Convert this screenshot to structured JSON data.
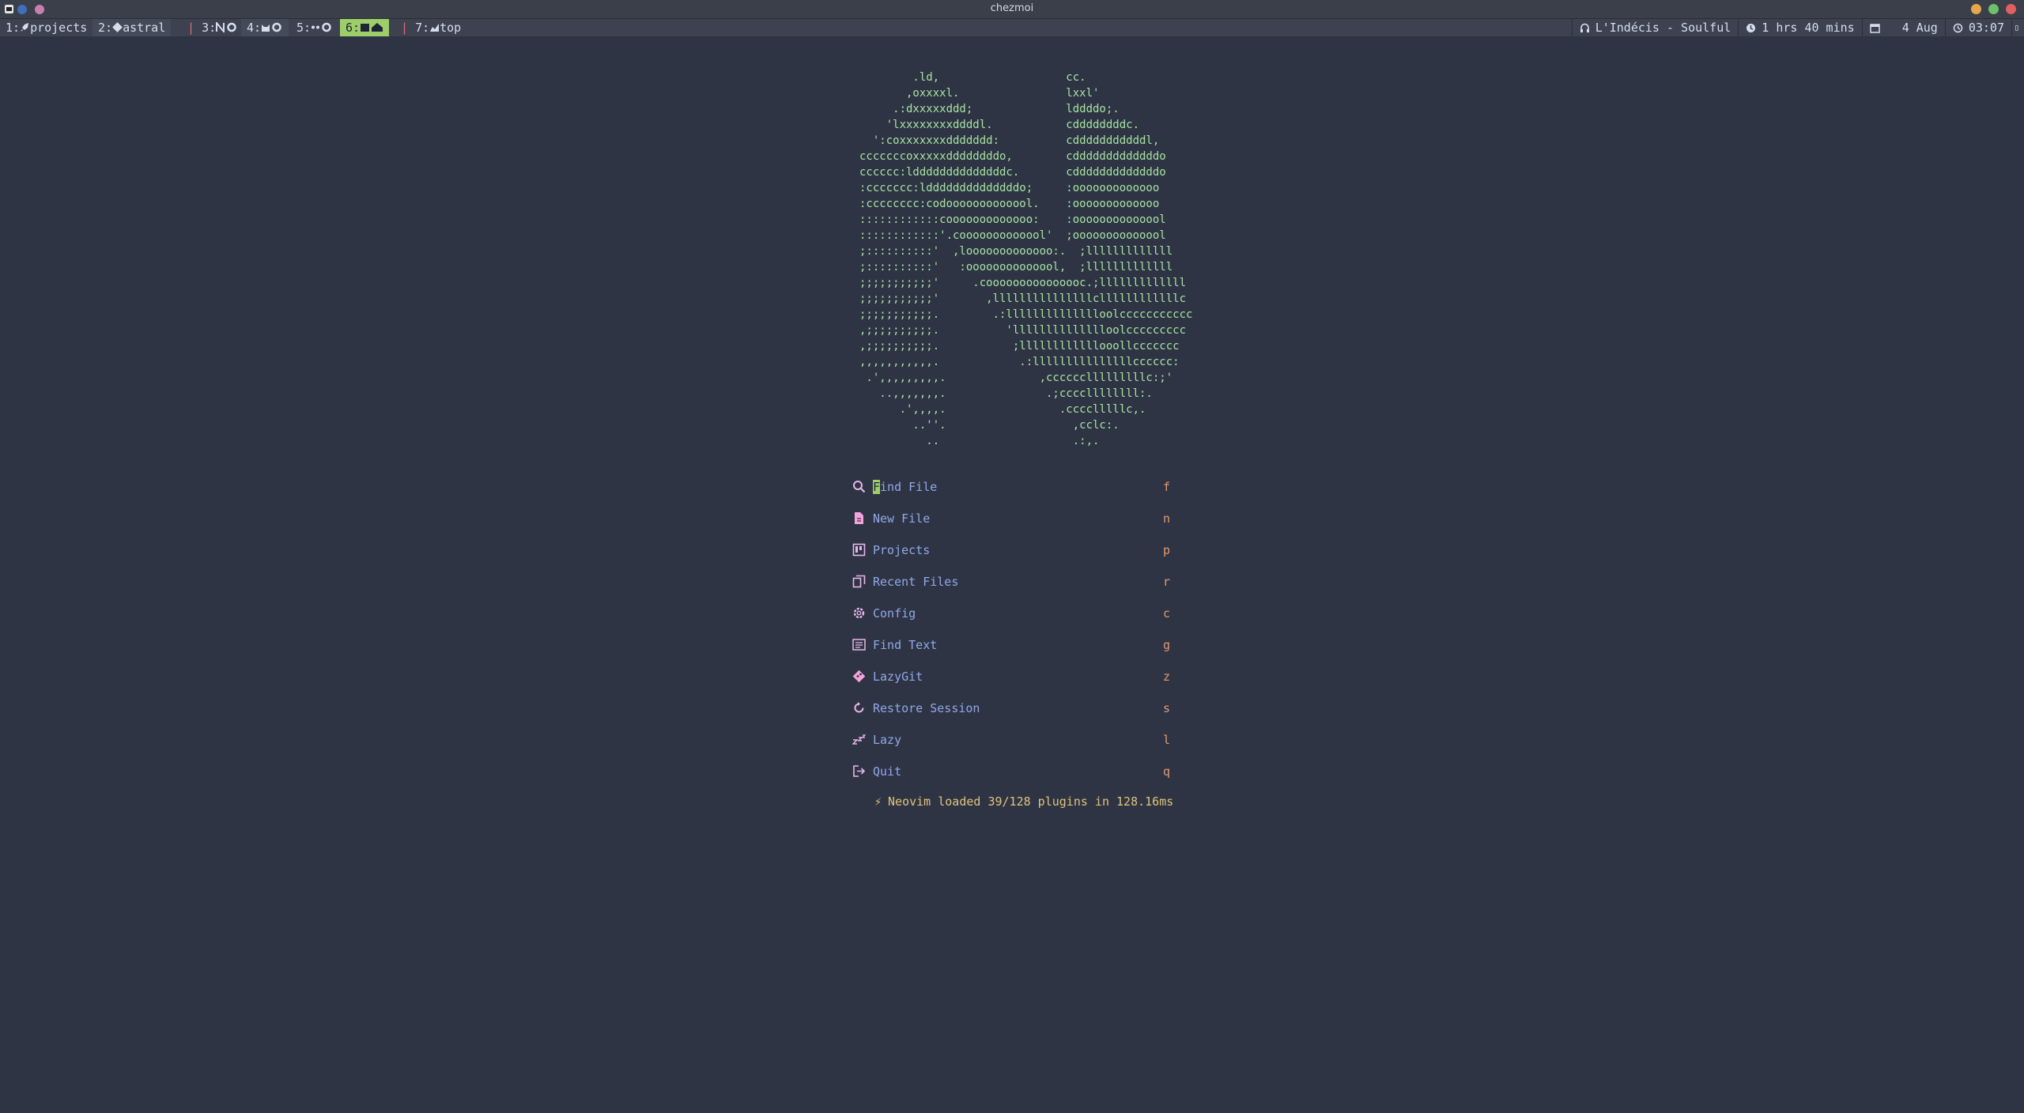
{
  "window": {
    "title": "chezmoi"
  },
  "tmux": {
    "workspaces": [
      {
        "index": "1:",
        "label": "projects",
        "icon": "rocket-icon"
      },
      {
        "index": "2:",
        "label": "astral",
        "icon": "git-icon"
      },
      {
        "index": "3:",
        "label": "",
        "icon": "neovim-gear-icon",
        "alert": true
      },
      {
        "index": "4:",
        "label": "",
        "icon": "cat-gear-icon"
      },
      {
        "index": "5:",
        "label": "",
        "icon": "dots-gear-icon"
      },
      {
        "index": "6:",
        "label": "",
        "icon": "home-icon",
        "active": true
      },
      {
        "index": "7:",
        "label": "top",
        "icon": "chart-icon",
        "alert": true
      }
    ],
    "right": {
      "music": "L'Indécis - Soulful",
      "uptime": "1 hrs 40 mins",
      "date": "4 Aug",
      "time": "03:07"
    }
  },
  "dashboard": {
    "logo_lines": [
      "        .ld,                   cc.",
      "       ,oxxxxl.                lxxl'",
      "     .:dxxxxxddd;              lddddo;.",
      "    'lxxxxxxxxddddl.           cddddddddc.",
      "  ':coxxxxxxxddddddd:          cdddddddddddl,",
      "cccccccoxxxxxddddddddo,        cdddddddddddddo",
      "cccccc:lddddddddddddddc.       cdddddddddddddo",
      ":ccccccc:lddddddddddddddo;     :ooooooooooooo",
      ":cccccccc:codooooooooooool.    :ooooooooooooo",
      "::::::::::::cooooooooooooo:    :oooooooooooool",
      "::::::::::::'.cooooooooooool'  ;oooooooooooool",
      ";::::::::::'  ,looooooooooooo:.  ;lllllllllllll",
      ";::::::::::'   :oooooooooooool,  ;lllllllllllll",
      ";;;;;;;;;;;'     .cooooooooooooooc.;lllllllllllll",
      ";;;;;;;;;;;'       ,lllllllllllllllcllllllllllllc",
      ";;;;;;;;;;;.        .:lllllllllllllloolccccccccccc",
      ",;;;;;;;;;;.          'lllllllllllllloolccccccccc",
      ",;;;;;;;;;;.           ;llllllllllllooollccccccc",
      ",,,,,,,,,,,.            .:lllllllllllllllcccccc:",
      " .',,,,,,,,,.              ,cccccclllllllllc:;'",
      "   ..,,,,,,,.               .;ccccllllllll:.",
      "      .',,,,.                 .cccclllllc,.",
      "        ..''.                   ,cclc:.",
      "          ..                    .:,."
    ],
    "menu": [
      {
        "icon": "search-icon",
        "label": "Find File",
        "key": "f"
      },
      {
        "icon": "file-icon",
        "label": "New File",
        "key": "n"
      },
      {
        "icon": "projects-icon",
        "label": "Projects",
        "key": "p"
      },
      {
        "icon": "recent-files-icon",
        "label": "Recent Files",
        "key": "r"
      },
      {
        "icon": "gear-icon",
        "label": "Config",
        "key": "c"
      },
      {
        "icon": "find-text-icon",
        "label": "Find Text",
        "key": "g"
      },
      {
        "icon": "git-icon",
        "label": "LazyGit",
        "key": "z"
      },
      {
        "icon": "restore-icon",
        "label": "Restore Session",
        "key": "s"
      },
      {
        "icon": "sleep-icon",
        "label": "Lazy",
        "key": "l"
      },
      {
        "icon": "exit-icon",
        "label": "Quit",
        "key": "q"
      }
    ],
    "footer": "Neovim loaded 39/128 plugins in 128.16ms"
  },
  "colors": {
    "background": "#2f3445",
    "logo": "#a6e3a1",
    "menu_label": "#8fa8e8",
    "menu_key": "#e39a6f",
    "icon": "#f5a3d9",
    "footer": "#e0c37a",
    "active_workspace": "#9ece6a"
  }
}
